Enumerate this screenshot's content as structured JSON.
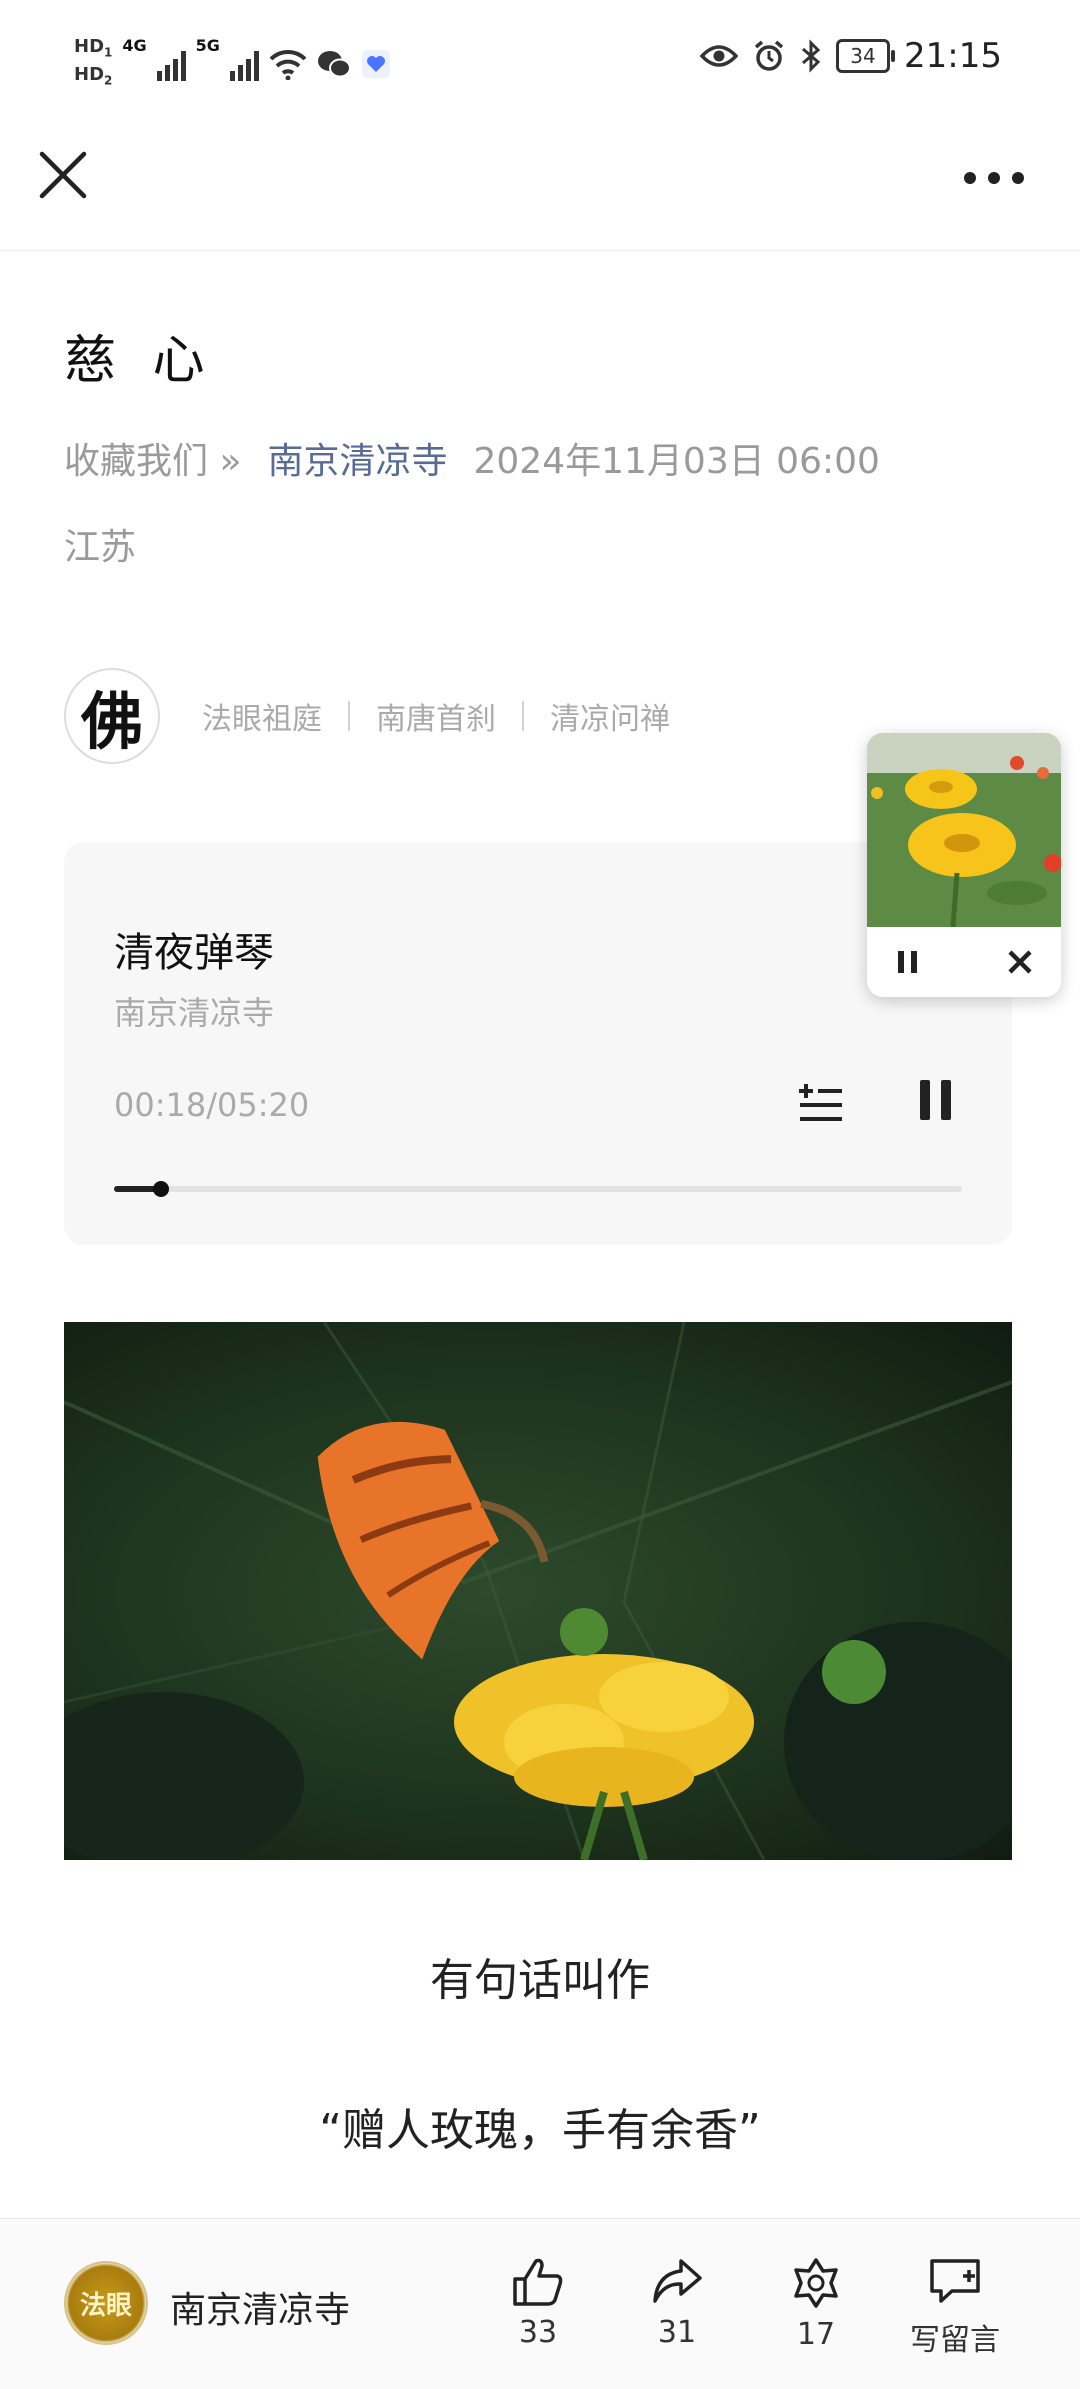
{
  "status_bar": {
    "hd1": "HD",
    "hd1_index": "1",
    "hd2": "HD",
    "hd2_index": "2",
    "net1": "4G",
    "net2": "5G",
    "battery": "34",
    "time": "21:15"
  },
  "article": {
    "title": "慈 心",
    "favorite_link": "收藏我们 »",
    "account": "南京清凉寺",
    "date": "2024年11月03日 06:00",
    "region": "江苏"
  },
  "profile": {
    "avatar_char": "佛",
    "tags": [
      "法眼祖庭",
      "南唐首刹",
      "清凉问禅"
    ]
  },
  "audio": {
    "title": "清夜弹琴",
    "artist": "南京清凉寺",
    "time": "00:18/05:20",
    "progress": 0.056
  },
  "body": {
    "line1": "有句话叫作",
    "line2": "“赠人玫瑰，手有余香”"
  },
  "bottom_bar": {
    "account_name": "南京清凉寺",
    "avatar_text": "法眼",
    "like_count": "33",
    "share_count": "31",
    "wow_count": "17",
    "comment_label": "写留言"
  }
}
